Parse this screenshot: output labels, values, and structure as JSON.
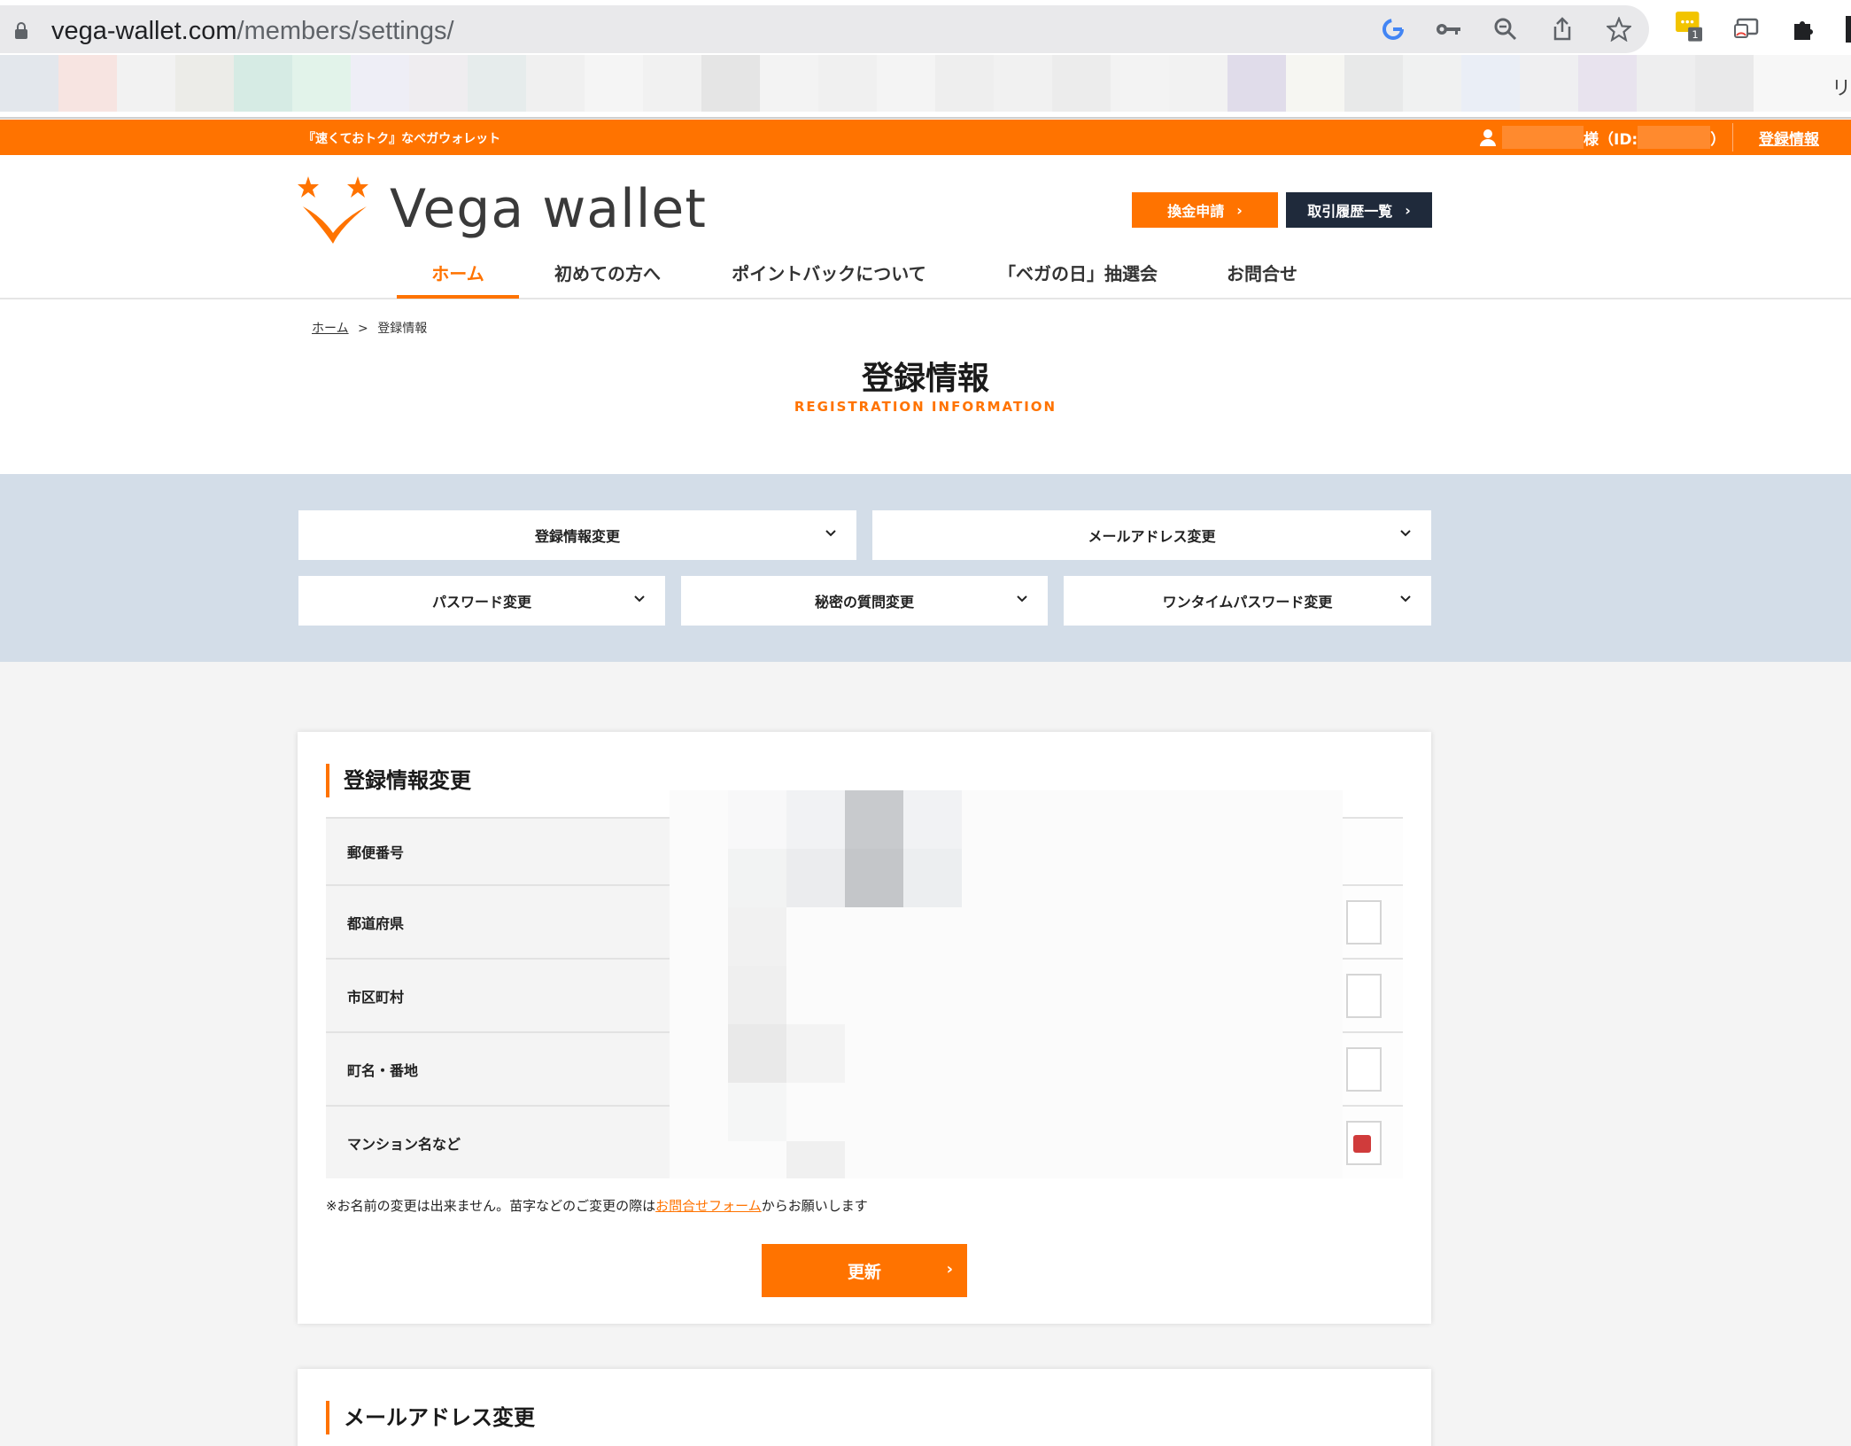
{
  "browser": {
    "url_host": "vega-wallet.com",
    "url_path": "/members/settings/",
    "extension_badge": "1",
    "bookmark_edge_text": "リ"
  },
  "site": {
    "tagline": "『速くておトク』なベガウォレット",
    "user_suffix": "様（ID:",
    "user_close": "）",
    "topbar_link": "登録情報",
    "brand": "Vega wallet",
    "accent_color": "#ff7300",
    "dark_color": "#1f2a3b"
  },
  "header": {
    "exchange_button": "換金申請",
    "history_button": "取引履歴一覧",
    "nav": [
      "ホーム",
      "初めての方へ",
      "ポイントバックについて",
      "「ベガの日」抽選会",
      "お問合せ"
    ]
  },
  "page": {
    "breadcrumb_home": "ホーム",
    "breadcrumb_sep": ">",
    "breadcrumb_current": "登録情報",
    "title": "登録情報",
    "subtitle": "REGISTRATION INFORMATION"
  },
  "section_menu": [
    "登録情報変更",
    "メールアドレス変更",
    "パスワード変更",
    "秘密の質問変更",
    "ワンタイムパスワード変更"
  ],
  "form": {
    "title": "登録情報変更",
    "rows": [
      "郵便番号",
      "都道府県",
      "市区町村",
      "町名・番地",
      "マンション名など"
    ],
    "note_before": "※お名前の変更は出来ません。苗字などのご変更の際は",
    "note_link": "お問合せフォーム",
    "note_after": "からお願いします",
    "submit": "更新"
  },
  "next_section": {
    "title": "メールアドレス変更"
  }
}
